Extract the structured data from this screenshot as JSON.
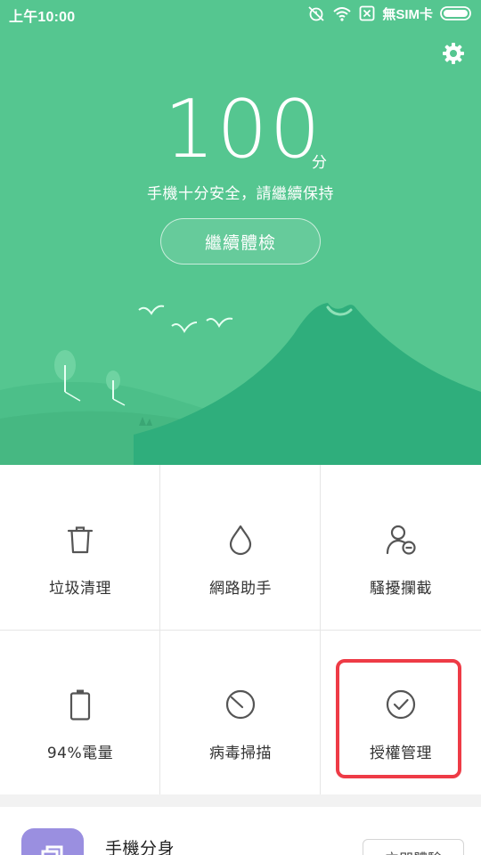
{
  "status_bar": {
    "time": "上午10:00",
    "carrier": "無SIM卡"
  },
  "hero": {
    "score_value": "100",
    "score_unit": "分",
    "subtitle": "手機十分安全，請繼續保持",
    "continue_button": "繼續體檢"
  },
  "colors": {
    "hero_green": "#55c690",
    "mountain_green": "#2fae7c",
    "hill_green": "#49bb86",
    "highlight_red": "#ee3b46",
    "app_icon_purple": "#9a8fe0"
  },
  "tools": [
    {
      "label": "垃圾清理",
      "icon": "trash-icon"
    },
    {
      "label": "網路助手",
      "icon": "droplet-icon"
    },
    {
      "label": "騷擾攔截",
      "icon": "block-user-icon"
    },
    {
      "label": "94%電量",
      "icon": "battery-icon"
    },
    {
      "label": "病毒掃描",
      "icon": "scan-dial-icon"
    },
    {
      "label": "授權管理",
      "icon": "check-circle-icon"
    }
  ],
  "bottom_card": {
    "title": "手機分身",
    "action_label": "立即體驗",
    "icon": "clone-app-icon"
  }
}
